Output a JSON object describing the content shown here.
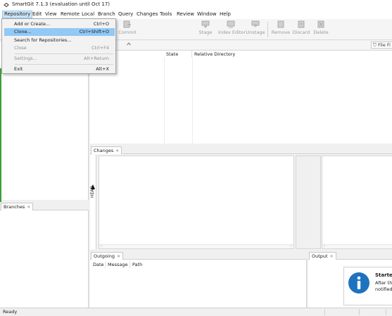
{
  "window": {
    "title": "SmartGit 7.1.3 (evaluation until Oct 17)"
  },
  "menubar": {
    "items": [
      "Repository",
      "Edit",
      "View",
      "Remote",
      "Local",
      "Branch",
      "Query",
      "Changes",
      "Tools",
      "Review",
      "Window",
      "Help"
    ]
  },
  "toolbar": {
    "commit": "Commit",
    "stage": "Stage",
    "index_editor": "Index Editor",
    "unstage": "Unstage",
    "remove": "Remove",
    "discard": "Discard",
    "delete": "Delete"
  },
  "files": {
    "filter_label": "File Fi",
    "columns": [
      "State",
      "Relative Directory"
    ]
  },
  "panels": {
    "branches": "Branches",
    "changes": "Changes",
    "outgoing": "Outgoing",
    "output": "Output",
    "head_label": "HEAD"
  },
  "outgoing": {
    "columns": [
      "Date",
      "Message",
      "Path"
    ]
  },
  "notification": {
    "title": "Started",
    "line1": "After the",
    "line2": "notified a"
  },
  "status": {
    "text": "Ready"
  },
  "repository_menu": {
    "items": [
      {
        "label": "Add or Create...",
        "shortcut": "Ctrl+O",
        "disabled": false,
        "highlighted": false
      },
      {
        "label": "Clone...",
        "shortcut": "Ctrl+Shift+O",
        "disabled": false,
        "highlighted": true
      },
      {
        "label": "Search for Repositories...",
        "shortcut": "",
        "disabled": false,
        "highlighted": false
      },
      {
        "label": "Close",
        "shortcut": "Ctrl+F4",
        "disabled": true,
        "highlighted": false
      },
      {
        "label": "Settings...",
        "shortcut": "Alt+Return",
        "disabled": true,
        "highlighted": false
      },
      {
        "label": "Exit",
        "shortcut": "Alt+X",
        "disabled": false,
        "highlighted": false
      }
    ]
  },
  "colors": {
    "accent": "#91c9f7",
    "menu_open": "#cce4f7",
    "info_icon": "#1e73be"
  },
  "icons": {
    "app": "smartgit-icon",
    "commit": "commit-icon",
    "stage": "stage-icon",
    "index_editor": "index-editor-icon",
    "unstage": "unstage-icon",
    "remove": "remove-icon",
    "discard": "discard-icon",
    "delete": "delete-icon",
    "info": "info-icon"
  }
}
